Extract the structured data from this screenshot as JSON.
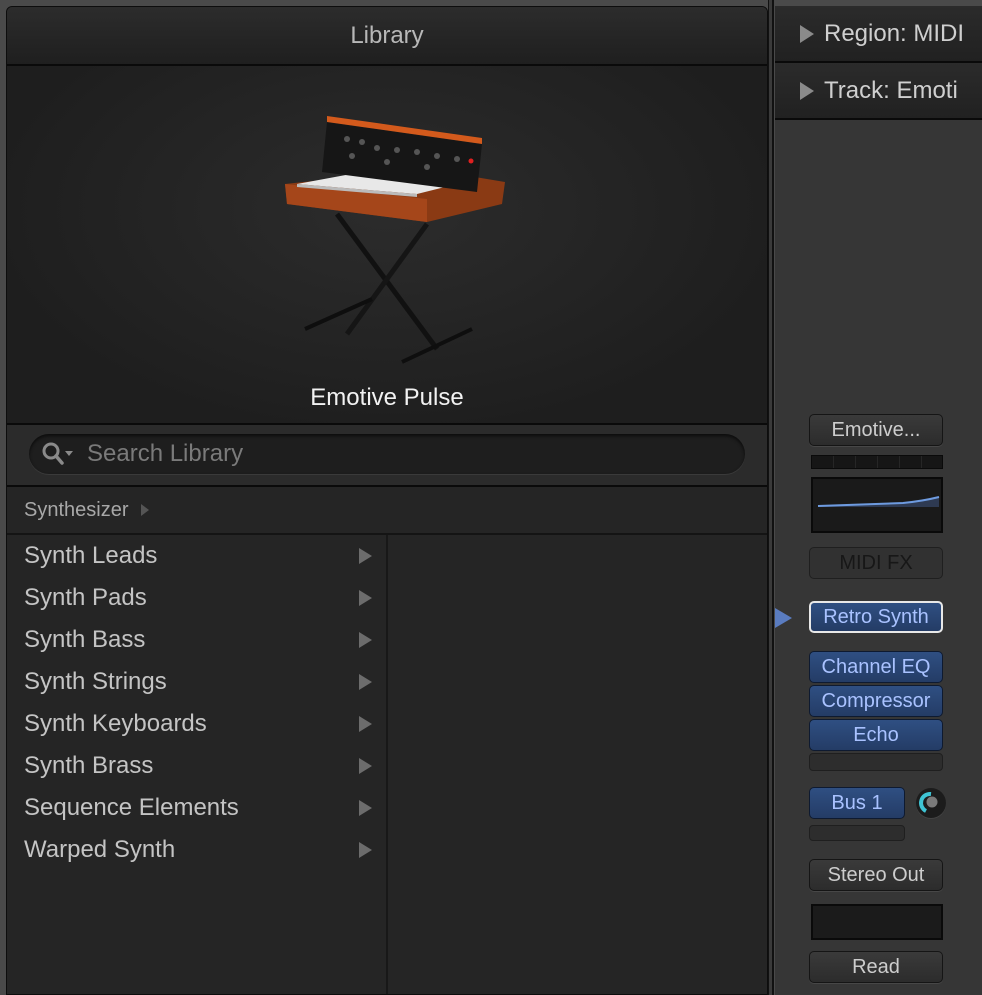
{
  "library": {
    "title": "Library",
    "preset_name": "Emotive Pulse",
    "preview_icon": "retro-synth-keyboard-on-stand",
    "search": {
      "placeholder": "Search Library",
      "value": "",
      "icon": "search-icon"
    },
    "breadcrumb": {
      "category": "Synthesizer"
    },
    "items": [
      {
        "label": "Synth Leads"
      },
      {
        "label": "Synth Pads"
      },
      {
        "label": "Synth Bass"
      },
      {
        "label": "Synth Strings"
      },
      {
        "label": "Synth Keyboards"
      },
      {
        "label": "Synth Brass"
      },
      {
        "label": "Sequence Elements"
      },
      {
        "label": "Warped Synth"
      }
    ]
  },
  "inspector": {
    "region_label": "Region: MIDI",
    "track_label": "Track:  Emoti",
    "channel_strip": {
      "setting_button": "Emotive...",
      "midi_fx": "MIDI FX",
      "instrument": "Retro Synth",
      "audio_fx": [
        "Channel EQ",
        "Compressor",
        "Echo"
      ],
      "send": "Bus 1",
      "output": "Stereo Out",
      "automation": "Read"
    }
  },
  "colors": {
    "plugin_blue": "#2f4f82",
    "plugin_text": "#a9c2ff",
    "send_knob_accent": "#3fc4d4",
    "eq_curve": "#6e9be0"
  }
}
